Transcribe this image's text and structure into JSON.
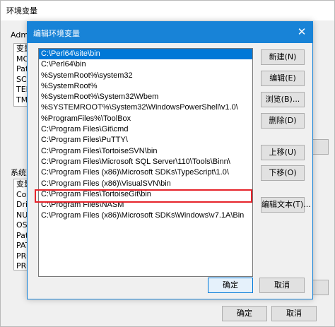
{
  "parent": {
    "title": "环境变量",
    "user_group_label": "Admi",
    "user_list": [
      "变量",
      "MO",
      "Pat",
      "SCI",
      "TEM",
      "TM"
    ],
    "system_group_label": "系统变",
    "system_list": [
      "变量",
      "Cor",
      "Driv",
      "NU",
      "OS",
      "Pat",
      "PAT",
      "PRO",
      "PRO"
    ],
    "ok_label": "确定",
    "cancel_label": "取消"
  },
  "dialog": {
    "title": "编辑环境变量",
    "close_glyph": "✕",
    "paths": [
      "C:\\Perl64\\site\\bin",
      "C:\\Perl64\\bin",
      "%SystemRoot%\\system32",
      "%SystemRoot%",
      "%SystemRoot%\\System32\\Wbem",
      "%SYSTEMROOT%\\System32\\WindowsPowerShell\\v1.0\\",
      "%ProgramFiles%\\ToolBox",
      "C:\\Program Files\\Git\\cmd",
      "C:\\Program Files\\PuTTY\\",
      "C:\\Program Files\\TortoiseSVN\\bin",
      "C:\\Program Files\\Microsoft SQL Server\\110\\Tools\\Binn\\",
      "C:\\Program Files (x86)\\Microsoft SDKs\\TypeScript\\1.0\\",
      "C:\\Program Files (x86)\\VisualSVN\\bin",
      "C:\\Program Files\\TortoiseGit\\bin",
      "C:\\Program Files\\NASM",
      "C:\\Program Files (x86)\\Microsoft SDKs\\Windows\\v7.1A\\Bin"
    ],
    "buttons": {
      "new": "新建(N)",
      "edit": "编辑(E)",
      "browse": "浏览(B)...",
      "delete": "删除(D)",
      "move_up": "上移(U)",
      "move_down": "下移(O)",
      "edit_text": "编辑文本(T)..."
    },
    "ok_label": "确定",
    "cancel_label": "取消"
  },
  "colors": {
    "accent": "#1883d7",
    "selection": "#0078d7",
    "highlight_box": "#e6232b"
  }
}
